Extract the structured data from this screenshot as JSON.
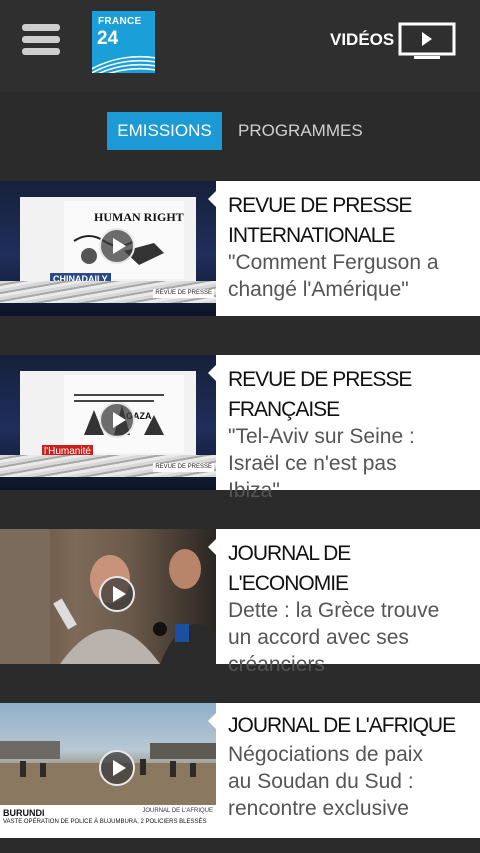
{
  "header": {
    "logo_line1": "FRANCE",
    "logo_line2": "24",
    "videos_label": "VIDÉOS"
  },
  "tabs": [
    {
      "label": "EMISSIONS",
      "active": true
    },
    {
      "label": "PROGRAMMES",
      "active": false
    }
  ],
  "colors": {
    "accent": "#1c9ad6",
    "background": "#2b2b2b",
    "card": "#ffffff"
  },
  "cards": [
    {
      "title_lines": [
        "REVUE DE PRESSE",
        "INTERNATIONALE"
      ],
      "subtitle_lines": [
        "\"Comment Ferguson a",
        "changé l'Amérique\""
      ],
      "thumb": {
        "paper_tag": "CHINADAILY",
        "cartoon_text": "HUMAN RIGHTS",
        "corner_tag": "REVUE DE PRESSE"
      }
    },
    {
      "title_lines": [
        "REVUE DE PRESSE",
        "FRANÇAISE"
      ],
      "subtitle_lines": [
        "\"Tel-Aviv sur Seine :",
        "Israël ce n'est pas",
        "Ibiza\""
      ],
      "thumb": {
        "paper_tag": "l'Humanité",
        "cartoon_text": "GAZA",
        "corner_tag": "REVUE DE PRESSE"
      }
    },
    {
      "title_lines": [
        "JOURNAL DE",
        "L'ECONOMIE"
      ],
      "subtitle_lines": [
        "Dette : la Grèce trouve",
        "un accord avec ses",
        "créanciers"
      ]
    },
    {
      "title_lines": [
        "JOURNAL DE L'AFRIQUE"
      ],
      "subtitle_lines": [
        "Négociations de paix",
        "au Soudan du Sud :",
        "rencontre exclusive"
      ],
      "thumb": {
        "banner_title": "BURUNDI",
        "banner_text": "VASTE OPÉRATION DE POLICE À BUJUMBURA, 2 POLICIERS BLESSÉS",
        "banner_corner": "JOURNAL DE L'AFRIQUE"
      }
    }
  ]
}
